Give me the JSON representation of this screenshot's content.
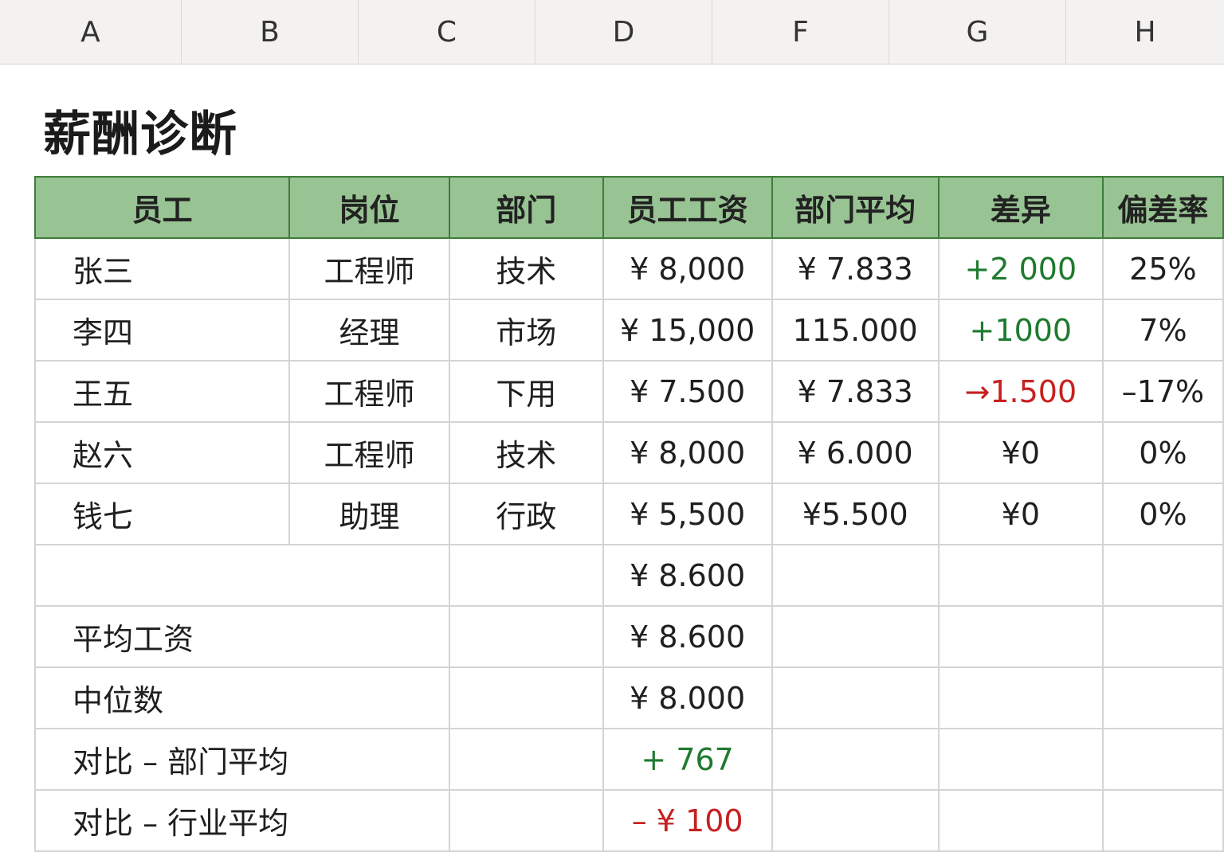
{
  "columns": [
    "A",
    "B",
    "C",
    "D",
    "F",
    "G",
    "H"
  ],
  "title": "薪酬诊断",
  "headers": [
    "员工",
    "岗位",
    "部门",
    "员工工资",
    "部门平均",
    "差异",
    "偏差率"
  ],
  "rows": [
    {
      "name": "张三",
      "role": "工程师",
      "dept": "技术",
      "salary": "¥ 8,000",
      "dept_avg": "¥ 7.833",
      "diff": "+2 000",
      "diff_tone": "pos",
      "rate": "25%"
    },
    {
      "name": "李四",
      "role": "经理",
      "dept": "市场",
      "salary": "¥ 15,000",
      "dept_avg": "115.000",
      "diff": "+1000",
      "diff_tone": "pos",
      "rate": "7%"
    },
    {
      "name": "王五",
      "role": "工程师",
      "dept": "下用",
      "salary": "¥ 7.500",
      "dept_avg": "¥ 7.833",
      "diff": "→1.500",
      "diff_tone": "neg",
      "rate": "–17%"
    },
    {
      "name": "赵六",
      "role": "工程师",
      "dept": "技术",
      "salary": "¥ 8,000",
      "dept_avg": "¥ 6.000",
      "diff": "¥0",
      "diff_tone": "",
      "rate": "0%"
    },
    {
      "name": "钱七",
      "role": "助理",
      "dept": "行政",
      "salary": "¥ 5,500",
      "dept_avg": "¥5.500",
      "diff": "¥0",
      "diff_tone": "",
      "rate": "0%"
    }
  ],
  "summary": [
    {
      "label": "",
      "value": "¥ 8.600",
      "tone": ""
    },
    {
      "label": "平均工资",
      "value": "¥ 8.600",
      "tone": ""
    },
    {
      "label": "中位数",
      "value": "¥ 8.000",
      "tone": ""
    },
    {
      "label": "对比 – 部门平均",
      "value": "+ 767",
      "tone": "pos"
    },
    {
      "label": "对比 – 行业平均",
      "value": "– ¥ 100",
      "tone": "neg"
    }
  ],
  "colors": {
    "header_fill": "#98c393",
    "header_border": "#3f7c3a",
    "positive": "#1e7a2e",
    "negative": "#c62121"
  }
}
